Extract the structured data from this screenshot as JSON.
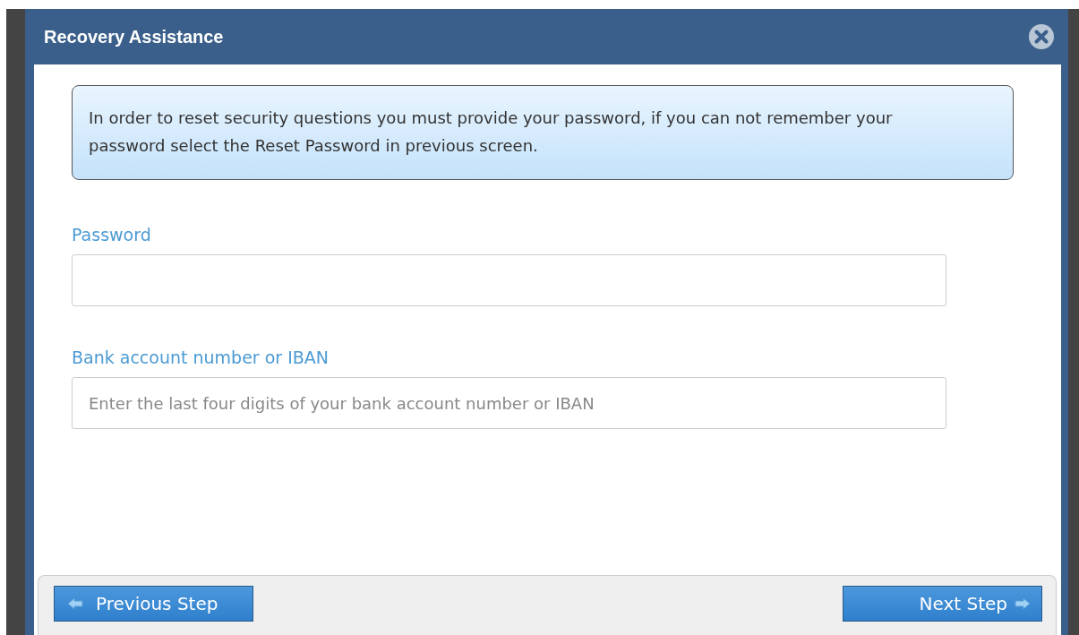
{
  "window": {
    "title": "Recovery Assistance"
  },
  "notice": "In order to reset security questions you must provide your password, if you can not remember your password select the Reset Password in previous screen.",
  "fields": [
    {
      "label": "Password"
    },
    {
      "label": "Bank account number or IBAN",
      "placeholder": "Enter the last four digits of your bank account number or IBAN"
    }
  ],
  "buttons": [
    {
      "label": "Previous Step",
      "kind": "previous"
    },
    {
      "label": "Next Step",
      "kind": "next"
    }
  ]
}
